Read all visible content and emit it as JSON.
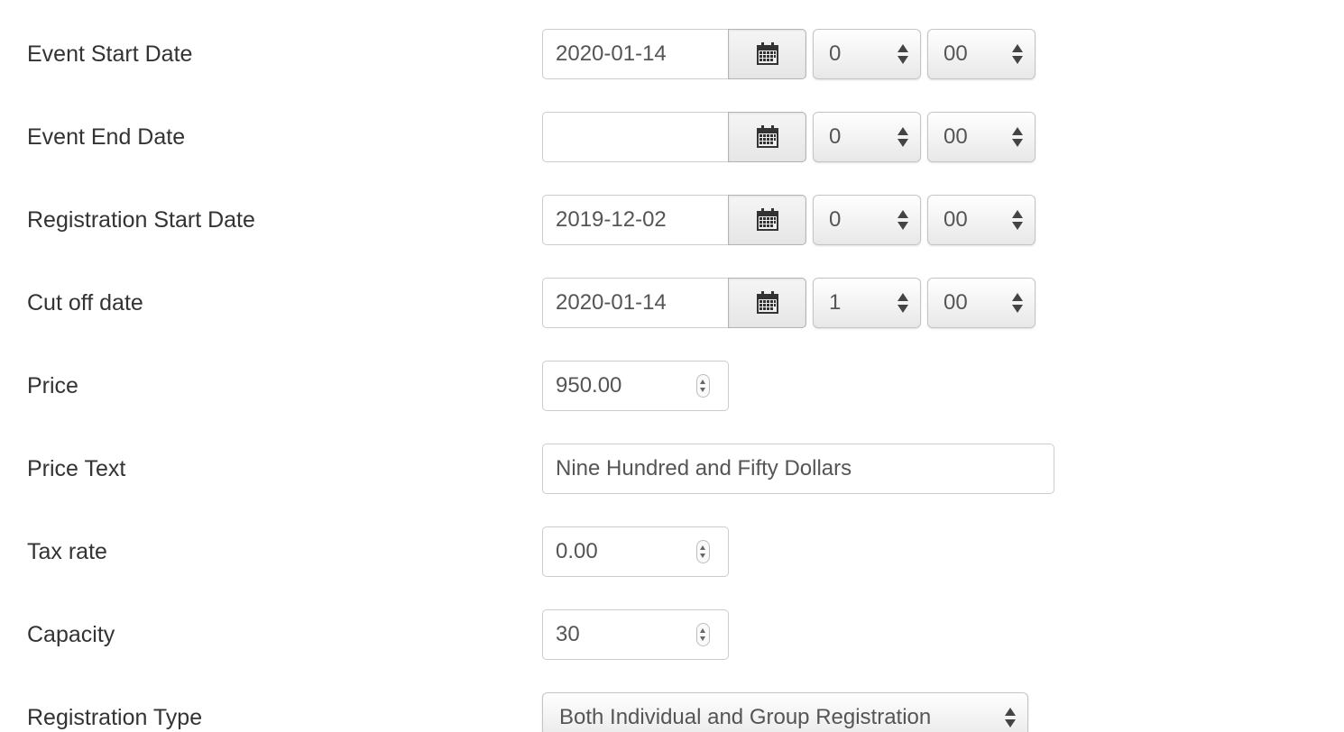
{
  "fields": {
    "event_start": {
      "label": "Event Start Date",
      "date": "2020-01-14",
      "hour": "0",
      "minute": "00"
    },
    "event_end": {
      "label": "Event End Date",
      "date": "",
      "hour": "0",
      "minute": "00"
    },
    "registration_start": {
      "label": "Registration Start Date",
      "date": "2019-12-02",
      "hour": "0",
      "minute": "00"
    },
    "cut_off": {
      "label": "Cut off date",
      "date": "2020-01-14",
      "hour": "1",
      "minute": "00"
    },
    "price": {
      "label": "Price",
      "value": "950.00"
    },
    "price_text": {
      "label": "Price Text",
      "value": "Nine Hundred and Fifty Dollars"
    },
    "tax_rate": {
      "label": "Tax rate",
      "value": "0.00"
    },
    "capacity": {
      "label": "Capacity",
      "value": "30"
    },
    "registration_type": {
      "label": "Registration Type",
      "value": "Both Individual and Group Registration"
    }
  },
  "icons": {
    "calendar": "calendar-icon",
    "select_arrows": "updown-arrows-icon",
    "spinner": "number-spinner-icon"
  }
}
